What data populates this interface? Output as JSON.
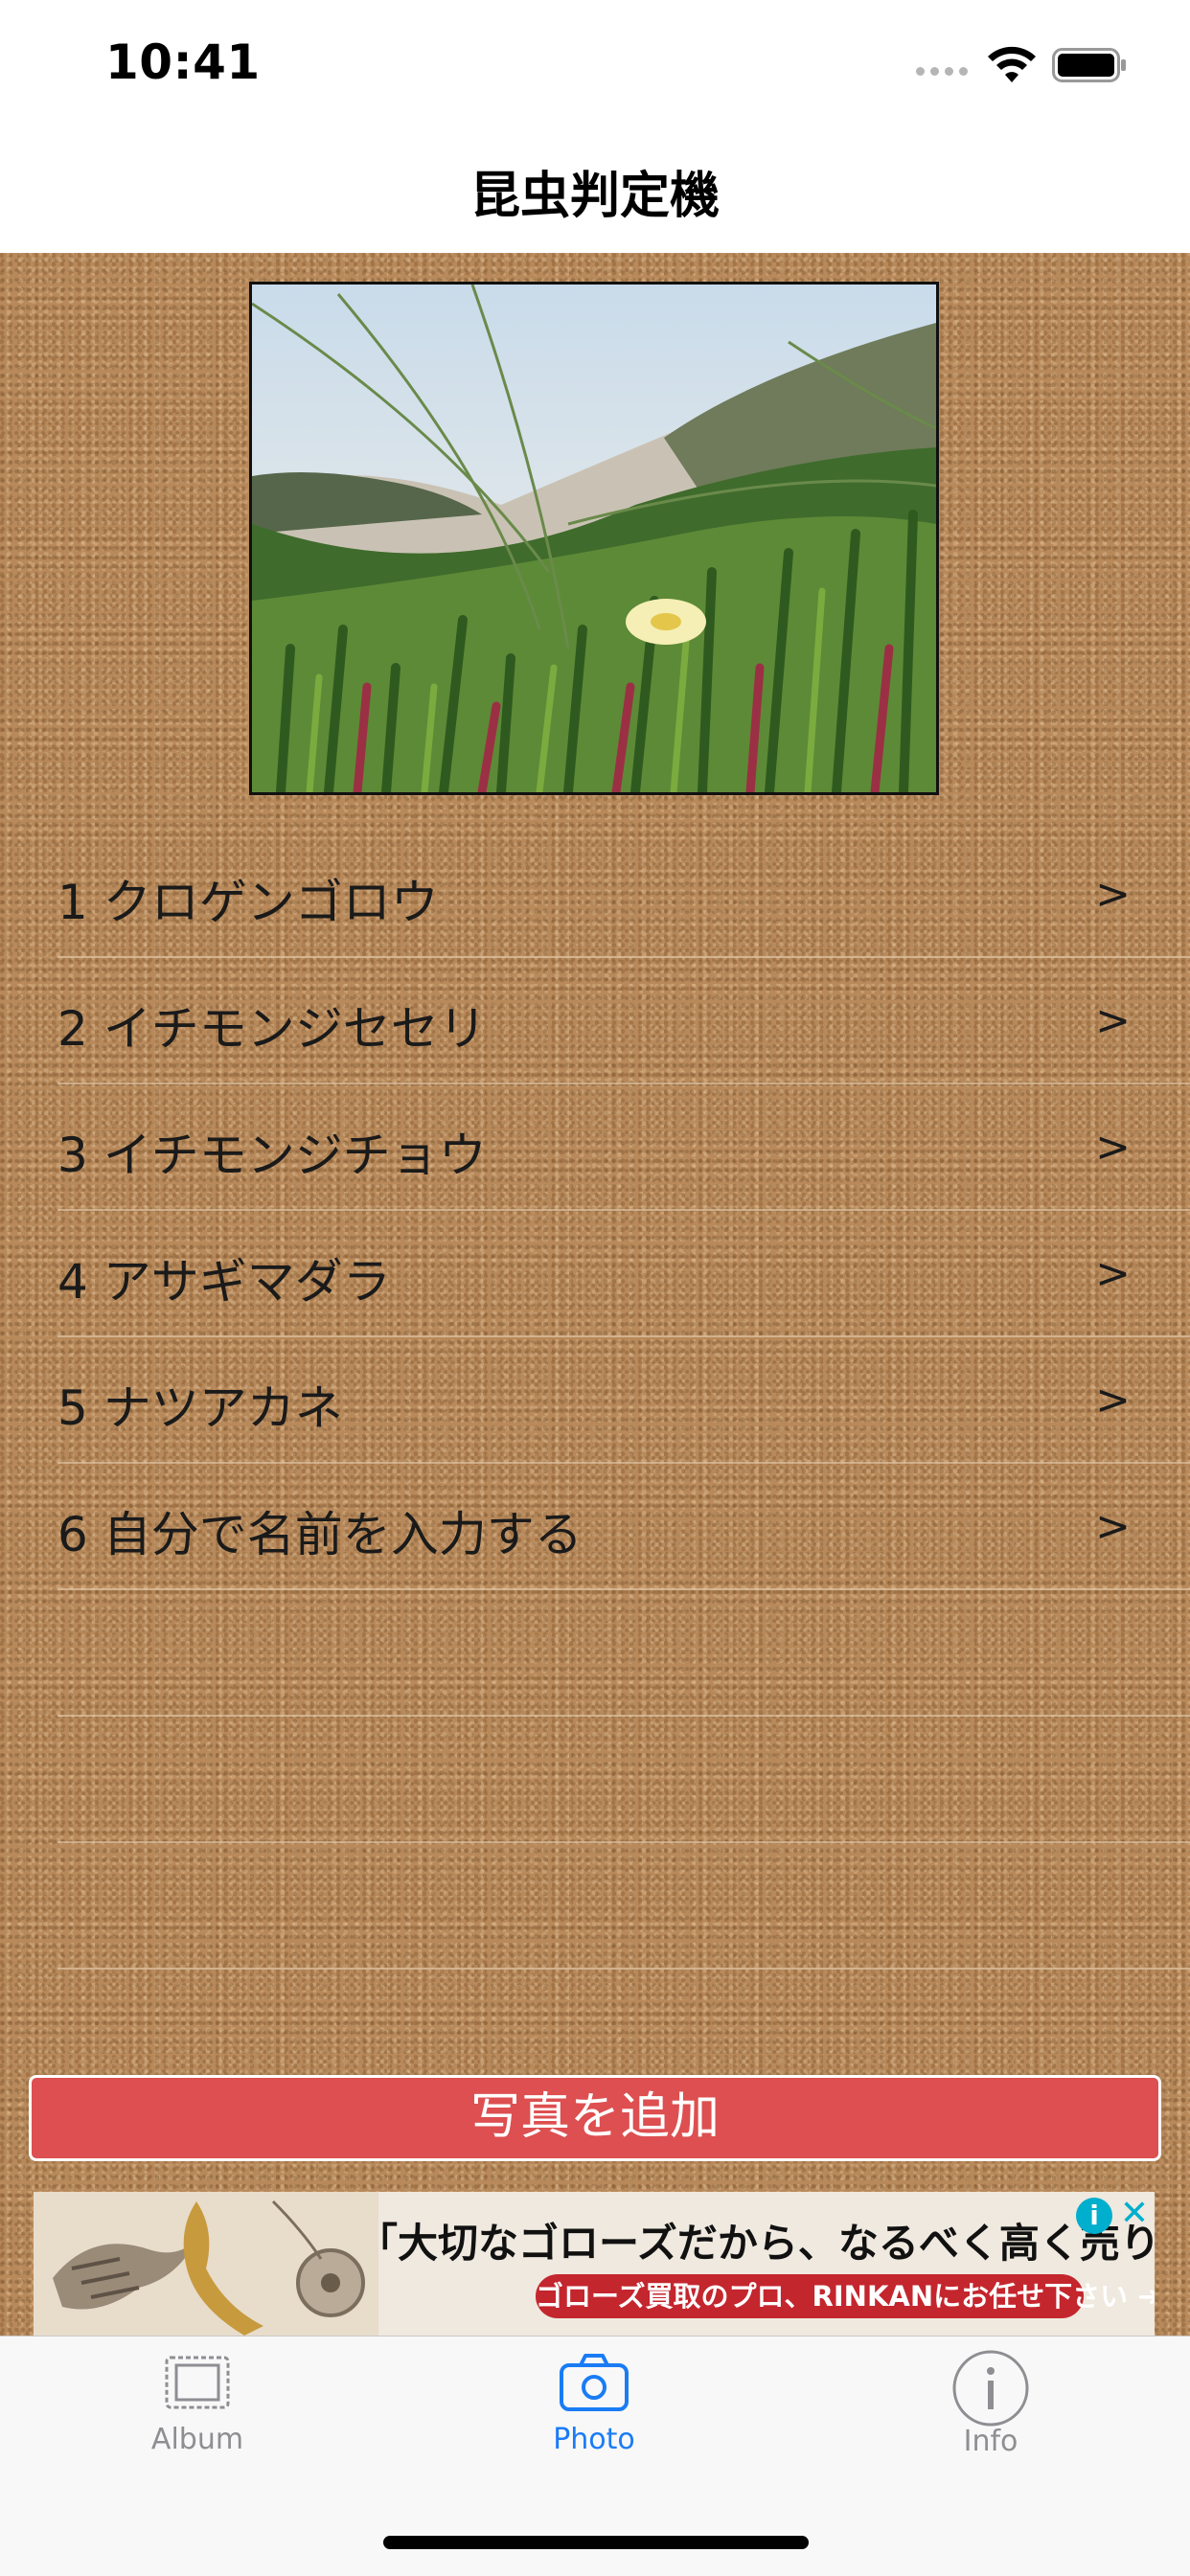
{
  "status_bar": {
    "time": "10:41"
  },
  "nav": {
    "title": "昆虫判定機"
  },
  "photo": {
    "description_icon": "photo-preview"
  },
  "list": {
    "items": [
      {
        "label": "1 クロゲンゴロウ",
        "chevron": ">"
      },
      {
        "label": "2 イチモンジセセリ",
        "chevron": ">"
      },
      {
        "label": "3 イチモンジチョウ",
        "chevron": ">"
      },
      {
        "label": "4 アサギマダラ",
        "chevron": ">"
      },
      {
        "label": "5 ナツアカネ",
        "chevron": ">"
      },
      {
        "label": "6 自分で名前を入力する",
        "chevron": ">"
      }
    ]
  },
  "add_button": {
    "label": "写真を追加"
  },
  "ad": {
    "headline": "「大切なゴローズだから、なるべく高く売りたい」",
    "sub": "ゴローズ買取のプロ、RINKANにお任せ下さい ➜",
    "info": "i",
    "close": "✕"
  },
  "tabs": [
    {
      "label": "Album",
      "icon": "album-icon",
      "color": "#8e8e93"
    },
    {
      "label": "Photo",
      "icon": "camera-icon",
      "color": "#1a7cf5"
    },
    {
      "label": "Info",
      "icon": "info-icon",
      "color": "#8e8e93"
    }
  ],
  "colors": {
    "accent": "#1a7cf5",
    "button": "#dd4f50",
    "cork": "#b8895a"
  }
}
